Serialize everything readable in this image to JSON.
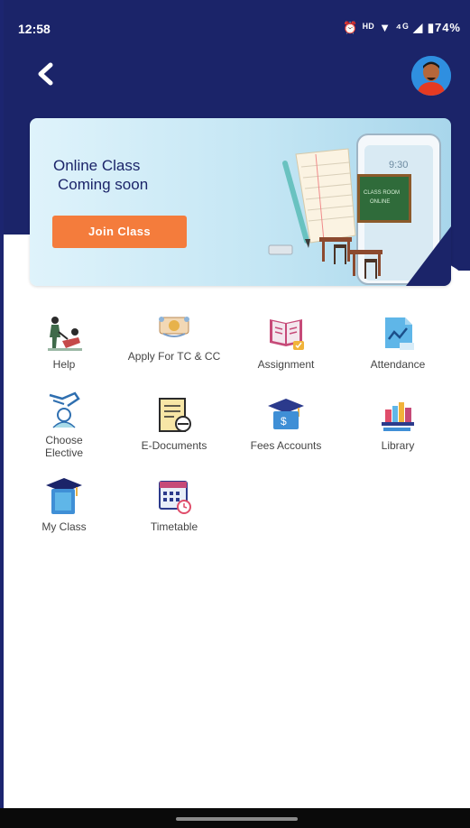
{
  "status_bar": {
    "time": "12:58",
    "icons_text": "⏰ ᴴᴰ ▼ ⁴ᴳ ◢ ▮74%"
  },
  "header": {
    "back_icon": "chevron-left-icon",
    "avatar": "user-avatar"
  },
  "banner": {
    "title_line1": "Online Class",
    "title_line2": "Coming soon",
    "join_button": "Join Class",
    "phone_time": "9:30",
    "board_line1": "CLASS ROOM",
    "board_line2": "ONLINE",
    "accent_color": "#f47c3c"
  },
  "menu": {
    "items": [
      {
        "label": "Help",
        "icon": "help-people-icon"
      },
      {
        "label": "Apply For TC & CC",
        "icon": "certificate-icon"
      },
      {
        "label": "Assignment",
        "icon": "open-book-icon"
      },
      {
        "label": "Attendance",
        "icon": "chart-document-icon"
      },
      {
        "label": "Choose Elective",
        "icon": "choose-hand-icon"
      },
      {
        "label": "E-Documents",
        "icon": "e-document-icon"
      },
      {
        "label": "Fees Accounts",
        "icon": "fees-cap-icon"
      },
      {
        "label": "Library",
        "icon": "library-books-icon"
      },
      {
        "label": "My Class",
        "icon": "my-class-icon"
      },
      {
        "label": "Timetable",
        "icon": "calendar-clock-icon"
      }
    ]
  },
  "colors": {
    "header_bg": "#1b2469",
    "button": "#f47c3c"
  }
}
